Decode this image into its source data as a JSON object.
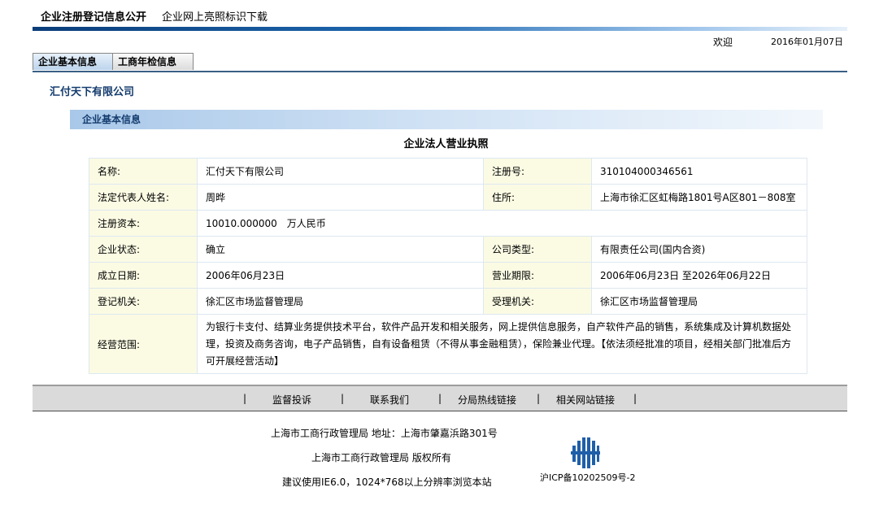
{
  "topnav": {
    "title": "企业注册登记信息公开",
    "download": "企业网上亮照标识下载"
  },
  "header": {
    "welcome": "欢迎",
    "date": "2016年01月07日"
  },
  "tabs": [
    {
      "label": "企业基本信息"
    },
    {
      "label": "工商年检信息"
    }
  ],
  "company_name": "汇付天下有限公司",
  "section_title": "企业基本信息",
  "table_title": "企业法人营业执照",
  "info": {
    "name_label": "名称:",
    "name_value": "汇付天下有限公司",
    "regno_label": "注册号:",
    "regno_value": "310104000346561",
    "legal_label": "法定代表人姓名:",
    "legal_value": "周晔",
    "address_label": "住所:",
    "address_value": "上海市徐汇区虹梅路1801号A区801－808室",
    "capital_label": "注册资本:",
    "capital_value": "10010.000000　万人民币",
    "status_label": "企业状态:",
    "status_value": "确立",
    "type_label": "公司类型:",
    "type_value": "有限责任公司(国内合资)",
    "founded_label": "成立日期:",
    "founded_value": "2006年06月23日",
    "term_label": "营业期限:",
    "term_value": "2006年06月23日 至2026年06月22日",
    "authority_label": "登记机关:",
    "authority_value": "徐汇区市场监督管理局",
    "acceptor_label": "受理机关:",
    "acceptor_value": "徐汇区市场监督管理局",
    "scope_label": "经营范围:",
    "scope_value": "为银行卡支付、结算业务提供技术平台，软件产品开发和相关服务，网上提供信息服务，自产软件产品的销售，系统集成及计算机数据处理，投资及商务咨询，电子产品销售，自有设备租赁（不得从事金融租赁），保险兼业代理。【依法须经批准的项目，经相关部门批准后方可开展经营活动】"
  },
  "footer_nav": [
    {
      "label": "监督投诉"
    },
    {
      "label": "联系我们"
    },
    {
      "label": "分局热线链接"
    },
    {
      "label": "相关网站链接"
    }
  ],
  "footer": {
    "line1": "上海市工商行政管理局  地址：上海市肇嘉浜路301号",
    "line2": "上海市工商行政管理局  版权所有",
    "line3": "建议使用IE6.0，1024*768以上分辨率浏览本站",
    "icp": "沪ICP备10202509号-2"
  },
  "colors": {
    "accent_dark": "#0a3d7a",
    "label_bg": "#fbfbe4",
    "section_head": "#a9c8e9",
    "footnav_bg": "#dadada"
  }
}
